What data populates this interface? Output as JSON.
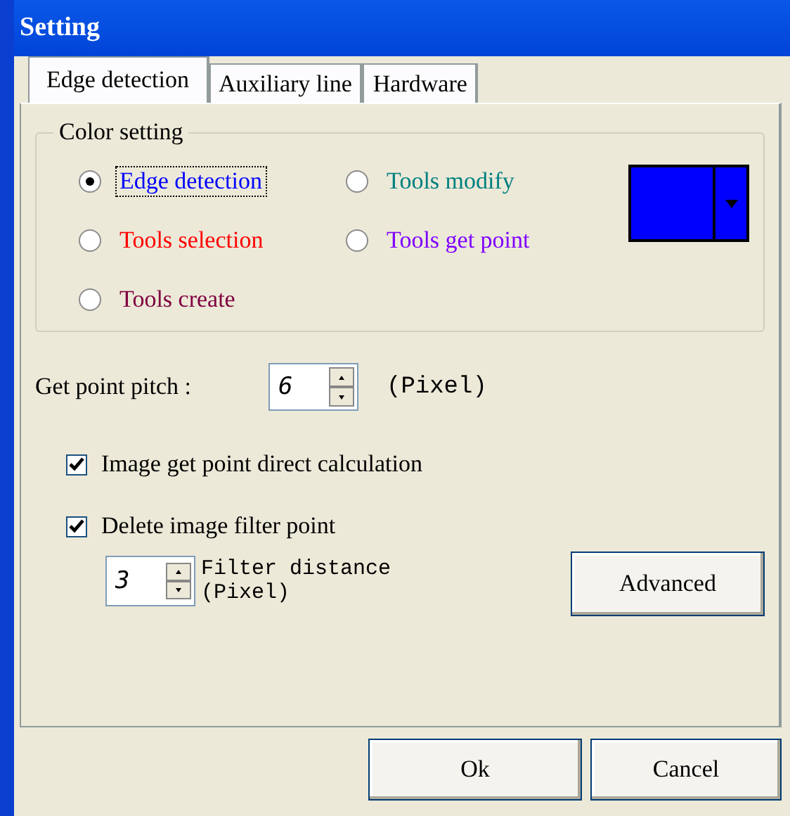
{
  "window": {
    "title": "Setting"
  },
  "tabs": [
    {
      "label": "Edge detection",
      "selected": true
    },
    {
      "label": "Auxiliary line",
      "selected": false
    },
    {
      "label": "Hardware",
      "selected": false
    }
  ],
  "color_setting": {
    "title": "Color setting",
    "options": [
      {
        "label": "Edge detection",
        "selected": true,
        "color": "#0000ff"
      },
      {
        "label": "Tools modify",
        "selected": false,
        "color": "#008080"
      },
      {
        "label": "Tools selection",
        "selected": false,
        "color": "#ff0000"
      },
      {
        "label": "Tools get point",
        "selected": false,
        "color": "#8000ff"
      },
      {
        "label": "Tools create",
        "selected": false,
        "color": "#800040"
      }
    ],
    "swatch": {
      "color": "#0000ff"
    }
  },
  "pitch": {
    "label": "Get point pitch :",
    "value": "6",
    "unit": "(Pixel)"
  },
  "checks": [
    {
      "label": "Image get point direct calculation",
      "checked": true
    },
    {
      "label": "Delete image filter point",
      "checked": true
    }
  ],
  "filter": {
    "value": "3",
    "label": "Filter distance",
    "unit": "(Pixel)"
  },
  "advanced_button": "Advanced",
  "buttons": [
    "Ok",
    "Cancel"
  ]
}
